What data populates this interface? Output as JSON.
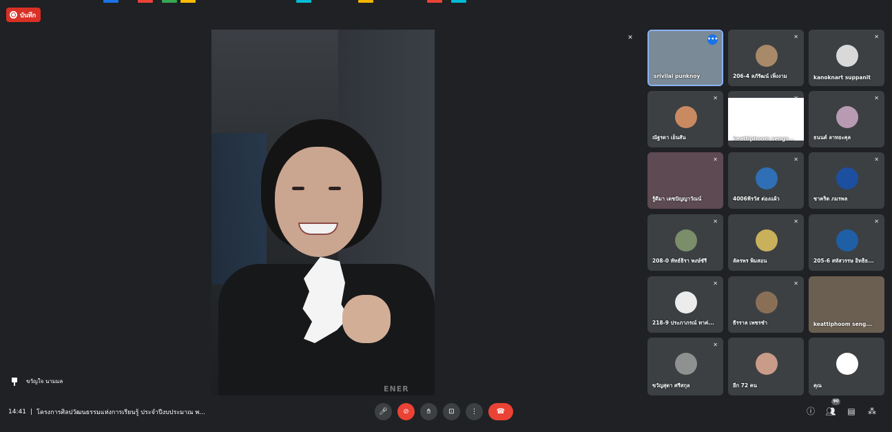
{
  "recording": {
    "label": "บันทึก"
  },
  "main": {
    "speaker_name": "ขวัญใจ นามมล",
    "shirt_text": "ENER"
  },
  "participants": [
    {
      "name": "srivilai punknoy",
      "color": "#7a8a96"
    },
    {
      "name": "206-4 ลภัรัฒน์ เพิ่งงาม",
      "color": "#a88968"
    },
    {
      "name": "kanoknart suppanit",
      "color": "#d9d9d9"
    },
    {
      "name": "ณัฐรดา เย็นสัน",
      "color": "#c98a62"
    },
    {
      "name": "keattiphoom sengs...",
      "color": "#ffffff"
    },
    {
      "name": "ธนนต์ ลาทยะคุล",
      "color": "#b89ab3"
    },
    {
      "name": "รู้ดีมา เดชปัญญาวัณน์",
      "color": "#5e4a52"
    },
    {
      "name": "4006พีรวัส ต่องแผ้ว",
      "color": "#2f6fb5"
    },
    {
      "name": "ชาคริต ภมรพล",
      "color": "#1d4fa0"
    },
    {
      "name": "208-0 ทัทธ์ธิรา พงษ์ชัรี",
      "color": "#7a8e6a"
    },
    {
      "name": "ลัครพร พิมสอน",
      "color": "#c9b15c"
    },
    {
      "name": "205-6 สหัสวรรษ อิทธิธ...",
      "color": "#1f5fa5"
    },
    {
      "name": "218-9 ประภาภรณ์ ทาค่...",
      "color": "#ececec"
    },
    {
      "name": "ธีรราล เพชรชำ",
      "color": "#8a6f57"
    },
    {
      "name": "keattiphoom seng...",
      "color": "#6b5f52"
    },
    {
      "name": "ขวัญสุดา ศรีสกุล",
      "color": "#8f9090"
    },
    {
      "name": "อีก 72 คน",
      "color": "#c99c8a"
    },
    {
      "name": "คุณ",
      "color": "#ffffff"
    }
  ],
  "bottom": {
    "time": "14:41",
    "separator": "|",
    "meeting_title": "โครงการศิลปวัฒนธรรมแห่งการเรียนรู้ ประจำปีงบประมาณ พ...",
    "participant_count": "90"
  }
}
